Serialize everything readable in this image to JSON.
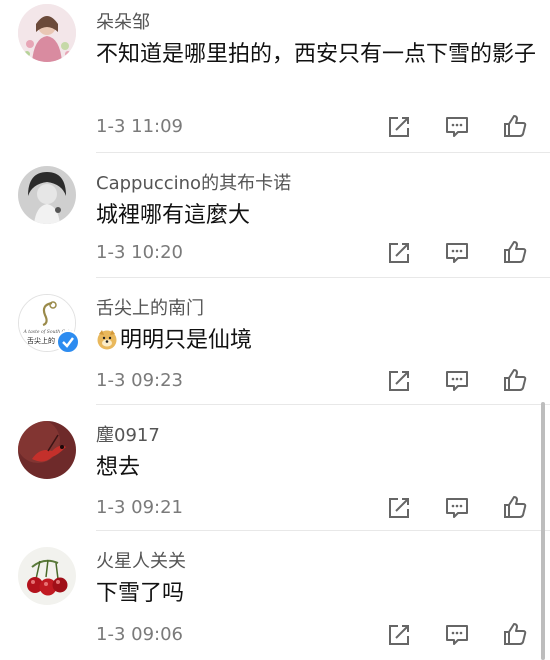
{
  "comments": [
    {
      "username": "朵朵邹",
      "content": "不知道是哪里拍的，西安只有一点下雪的影子",
      "time": "1-3 11:09",
      "avatar": "woman-portrait-avatar"
    },
    {
      "username": "Cappuccino的其布卡诺",
      "content": "城裡哪有這麼大",
      "time": "1-3 10:20",
      "avatar": "bw-woman-avatar"
    },
    {
      "username": "舌尖上的南门",
      "content": "明明只是仙境",
      "time": "1-3 09:23",
      "avatar": "logo-avatar",
      "verified": true,
      "emoji": "doge-emoji"
    },
    {
      "username": "麈0917",
      "content": "想去",
      "time": "1-3 09:21",
      "avatar": "red-bird-avatar"
    },
    {
      "username": "火星人关关",
      "content": "下雪了吗",
      "time": "1-3 09:06",
      "avatar": "cherries-avatar"
    }
  ],
  "avatar_logo_text": {
    "line1": "A taste of South Gate",
    "line2": "舌尖上的"
  },
  "icons": {
    "repost": "share-icon",
    "comment": "comment-icon",
    "like": "thumbs-up-icon"
  },
  "colors": {
    "username": "#555555",
    "content": "#111111",
    "time": "#7a7a7a",
    "icon": "#666666",
    "divider": "#e8e8e8",
    "verified": "#2d8cf0"
  }
}
